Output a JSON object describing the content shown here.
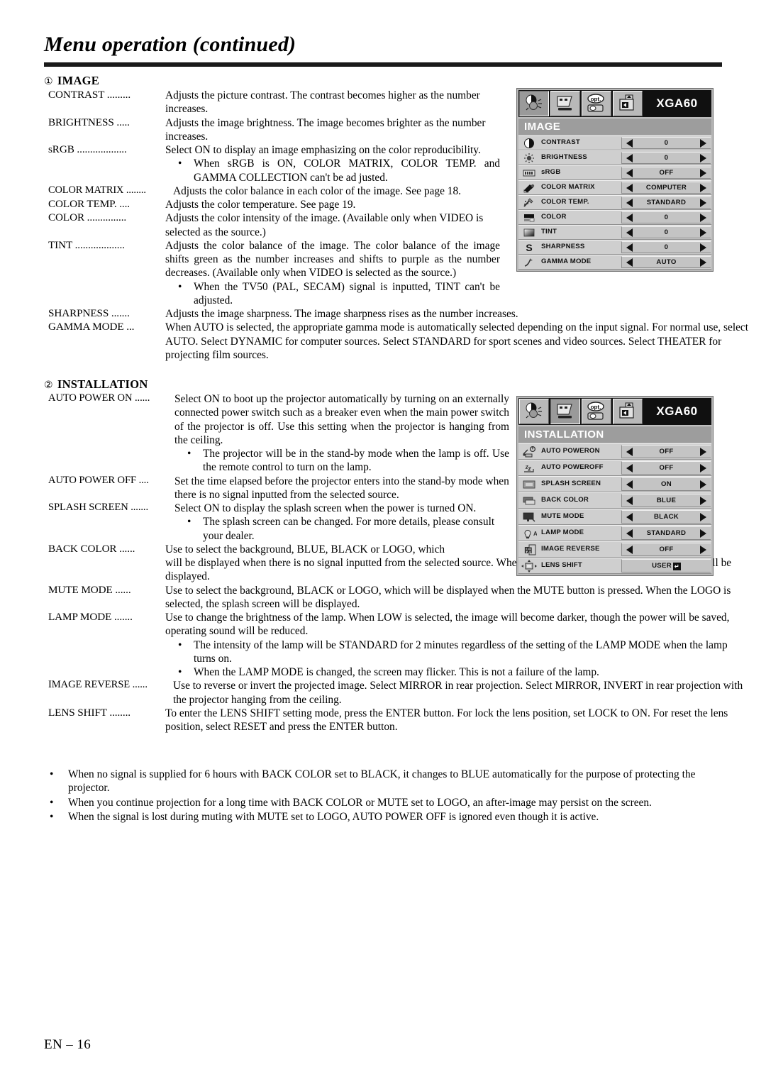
{
  "header": {
    "title": "Menu operation (continued)"
  },
  "footer": {
    "page_label": "EN – 16"
  },
  "sections": [
    {
      "number": "①",
      "title": "IMAGE",
      "entries": [
        {
          "term": "CONTRAST .........",
          "desc": "Adjusts the picture contrast. The contrast becomes higher as the number increases."
        },
        {
          "term": "BRIGHTNESS .....",
          "desc": "Adjusts the image brightness. The image becomes brighter as the number increases."
        },
        {
          "term": "sRGB ...................",
          "desc": "Select ON to display an image emphasizing on the color reproducibility.",
          "bullets": [
            "When sRGB is ON, COLOR MATRIX, COLOR TEMP. and GAMMA COLLECTION can't be ad justed."
          ]
        },
        {
          "term": "COLOR MATRIX ........",
          "desc": "Adjusts the color balance in each color of the image. See page 18."
        },
        {
          "term": "COLOR TEMP. ....",
          "desc": "Adjusts the color temperature. See page 19."
        },
        {
          "term": "COLOR ...............",
          "desc": "Adjusts the color intensity of the image. (Available only when VIDEO is selected as the source.)"
        },
        {
          "term": "TINT ...................",
          "desc": "Adjusts the color balance of the image. The color balance of the image shifts green as the number increases and shifts to purple as the number decreases. (Available only when VIDEO is selected as the source.)",
          "bullets": [
            "When the TV50 (PAL, SECAM) signal is inputted, TINT can't be adjusted."
          ]
        },
        {
          "term": "SHARPNESS .......",
          "desc": "Adjusts the image sharpness. The image sharpness rises as the number increases."
        },
        {
          "term": "GAMMA MODE ...",
          "desc": "When AUTO is selected, the appropriate gamma mode is automatically selected depending on the input signal. For normal use, select  AUTO. Select DYNAMIC for computer sources. Select STANDARD for  sport scenes and video sources. Select THEATER for projecting film sources."
        }
      ]
    },
    {
      "number": "②",
      "title": "INSTALLATION",
      "entries": [
        {
          "term": "AUTO POWER ON ......",
          "desc": "Select ON to boot up the projector automatically by turning on an externally connected power switch such as a breaker even when the main power switch of the projector is off. Use this setting when the projector is hanging from the ceiling.",
          "bullets": [
            "The projector will be in the stand-by mode when the lamp is off.  Use the remote control to turn on the lamp."
          ]
        },
        {
          "term": "AUTO POWER OFF ....",
          "desc": "Set the time elapsed before the projector enters into the stand-by mode when there is no signal inputted from the selected source."
        },
        {
          "term": "SPLASH SCREEN .......",
          "desc": "Select ON to display the splash screen when the power is turned ON.",
          "bullets": [
            "The splash screen can be changed. For more details, please consult your dealer."
          ]
        },
        {
          "term": "BACK COLOR ......",
          "desc": "Use to select the background, BLUE, BLACK or LOGO, which will be displayed when there is no signal inputted from the selected source. When the LOGO is selected, the splash screen will be displayed."
        },
        {
          "term": "MUTE MODE ......",
          "desc": "Use to select the background, BLACK or LOGO, which will be displayed when the MUTE button is pressed. When the LOGO is selected, the splash screen will be displayed."
        },
        {
          "term": "LAMP MODE .......",
          "desc": "Use to change the brightness of the lamp. When LOW is selected, the image will become darker, though the power will be saved, operating sound will be reduced.",
          "bullets": [
            "The intensity of the lamp will be STANDARD for 2 minutes regardless of the setting of the LAMP MODE when the lamp turns on.",
            "When the LAMP MODE is changed, the screen may flicker. This is not a failure of the lamp."
          ]
        },
        {
          "term": "IMAGE REVERSE ......",
          "desc": "Use to reverse or invert the projected image. Select MIRROR in rear projection. Select MIRROR, INVERT in rear projection with the projector hanging from the ceiling."
        },
        {
          "term": "LENS SHIFT ........",
          "desc": "To enter the LENS SHIFT setting mode, press the ENTER button. For lock the lens position, set LOCK to ON. For reset the lens position, select RESET and press the ENTER button."
        }
      ]
    }
  ],
  "notes": [
    "When no signal is supplied for 6 hours with BACK COLOR set to BLACK, it changes to BLUE automatically for the purpose of protecting the projector.",
    "When you continue projection for a long time with BACK COLOR or MUTE set to LOGO, an after-image may persist on the screen.",
    "When the signal is lost during muting with MUTE set to LOGO, AUTO POWER OFF is ignored even though it is active."
  ],
  "osd_image": {
    "signal": "XGA60",
    "section_title": "IMAGE",
    "tabs": [
      "image-tab-icon",
      "screen-tab-icon",
      "option-tab-icon",
      "signal-tab-icon"
    ],
    "active_tab_index": 0,
    "rows": [
      {
        "icon": "contrast-icon",
        "label": "CONTRAST",
        "value": "0",
        "arrows": true
      },
      {
        "icon": "brightness-icon",
        "label": "BRIGHTNESS",
        "value": "0",
        "arrows": true
      },
      {
        "icon": "srgb-icon",
        "label": "sRGB",
        "value": "OFF",
        "arrows": true
      },
      {
        "icon": "color-matrix-icon",
        "label": "COLOR MATRIX",
        "value": "COMPUTER",
        "arrows": true
      },
      {
        "icon": "color-temp-icon",
        "label": "COLOR TEMP.",
        "value": "STANDARD",
        "arrows": true
      },
      {
        "icon": "color-icon",
        "label": "COLOR",
        "value": "0",
        "arrows": true
      },
      {
        "icon": "tint-icon",
        "label": "TINT",
        "value": "0",
        "arrows": true
      },
      {
        "icon": "sharpness-icon",
        "label": "SHARPNESS",
        "value": "0",
        "arrows": true
      },
      {
        "icon": "gamma-mode-icon",
        "label": "GAMMA MODE",
        "value": "AUTO",
        "arrows": true
      }
    ]
  },
  "osd_installation": {
    "signal": "XGA60",
    "section_title": "INSTALLATION",
    "tabs": [
      "image-tab-icon",
      "screen-tab-icon",
      "option-tab-icon",
      "signal-tab-icon"
    ],
    "active_tab_index": 1,
    "rows": [
      {
        "icon": "auto-power-on-icon",
        "label_line1": "AUTO POWER",
        "label_line2": "ON",
        "value": "OFF",
        "arrows": true
      },
      {
        "icon": "auto-power-off-icon",
        "label_line1": "AUTO POWER",
        "label_line2": "OFF",
        "value": "OFF",
        "arrows": true
      },
      {
        "icon": "splash-screen-icon",
        "label_line1": "SPLASH SCREEN",
        "label_line2": "",
        "value": "ON",
        "arrows": true
      },
      {
        "icon": "back-color-icon",
        "label_line1": "BACK COLOR",
        "label_line2": "",
        "value": "BLUE",
        "arrows": true
      },
      {
        "icon": "mute-mode-icon",
        "label_line1": "MUTE MODE",
        "label_line2": "",
        "value": "BLACK",
        "arrows": true
      },
      {
        "icon": "lamp-mode-icon",
        "label_line1": "LAMP MODE",
        "label_line2": "",
        "value": "STANDARD",
        "arrows": true
      },
      {
        "icon": "image-reverse-icon",
        "label_line1": "IMAGE REVERSE",
        "label_line2": "",
        "value": "OFF",
        "arrows": true
      },
      {
        "icon": "lens-shift-icon",
        "label_line1": "LENS SHIFT",
        "label_line2": "",
        "value": "USER",
        "arrows": false,
        "enter_glyph": "↵"
      }
    ]
  },
  "colors": {
    "osd_background": "#b8b8b8",
    "osd_header": "#101010",
    "osd_section_bar": "#9d9d9d",
    "osd_row": "#cfcfcf",
    "osd_value_box": "#c4c4c4",
    "rule": "#1a1a1a"
  }
}
